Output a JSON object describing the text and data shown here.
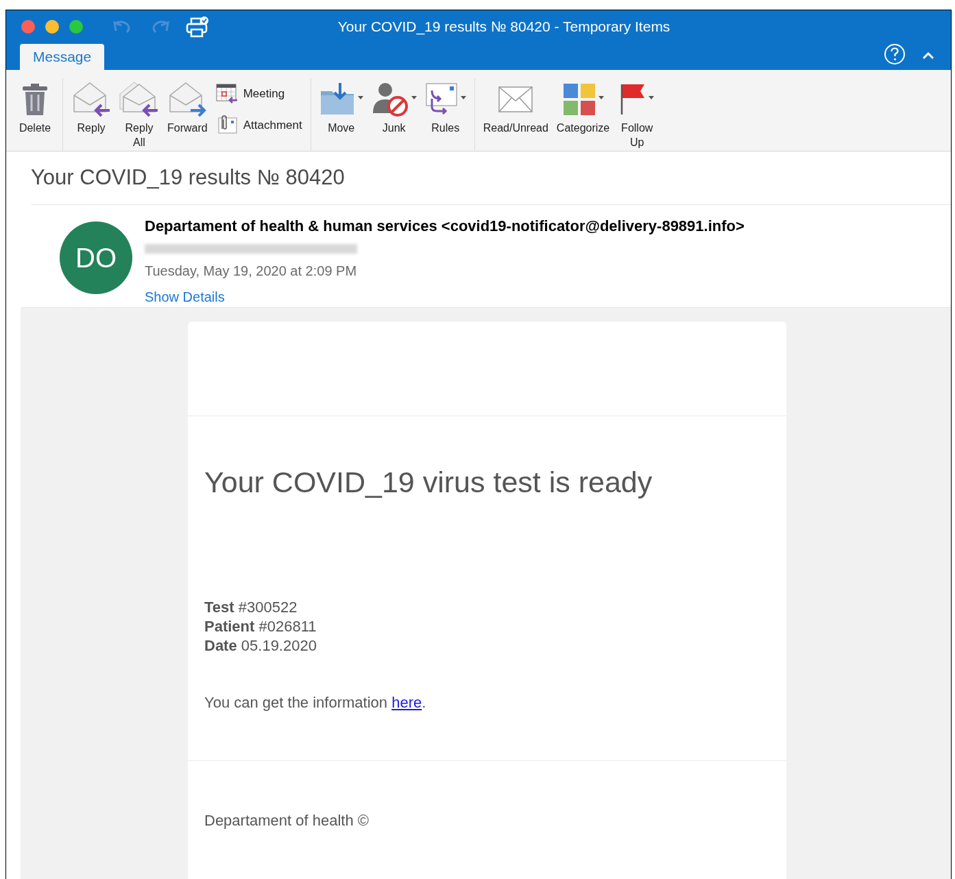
{
  "window": {
    "title": "Your COVID_19 results № 80420 - Temporary Items"
  },
  "tabs": [
    {
      "label": "Message",
      "selected": true
    }
  ],
  "ribbon": {
    "groups": [
      [
        {
          "label": "Delete",
          "kind": "large",
          "has_menu": false
        }
      ],
      [
        {
          "label": "Reply",
          "kind": "large",
          "has_menu": false
        },
        {
          "label": "Reply All",
          "kind": "large",
          "has_menu": false
        },
        {
          "label": "Forward",
          "kind": "large",
          "has_menu": false
        },
        {
          "label": "Meeting",
          "kind": "small",
          "has_menu": false
        },
        {
          "label": "Attachment",
          "kind": "small",
          "has_menu": false
        }
      ],
      [
        {
          "label": "Move",
          "kind": "large",
          "has_menu": true
        },
        {
          "label": "Junk",
          "kind": "large",
          "has_menu": true
        },
        {
          "label": "Rules",
          "kind": "large",
          "has_menu": true
        }
      ],
      [
        {
          "label": "Read/Unread",
          "kind": "large",
          "has_menu": false
        },
        {
          "label": "Categorize",
          "kind": "large",
          "has_menu": true
        },
        {
          "label": "Follow Up",
          "kind": "large",
          "has_menu": true
        }
      ]
    ]
  },
  "message": {
    "subject": "Your COVID_19 results № 80420",
    "avatar": {
      "initials": "DO",
      "color": "#23825a"
    },
    "sender": "Departament of health & human services <covid19-notificator@delivery-89891.info>",
    "date": "Tuesday, May 19, 2020 at 2:09 PM",
    "details_link": "Show Details"
  },
  "body": {
    "heading": "Your COVID_19 virus test is ready",
    "fields": [
      {
        "label": "Test",
        "value": "#300522"
      },
      {
        "label": "Patient",
        "value": "#026811"
      },
      {
        "label": "Date",
        "value": "05.19.2020"
      }
    ],
    "info_text": "You can get the information",
    "info_link": "here",
    "info_end": ".",
    "footer": "Departament of health ©"
  }
}
